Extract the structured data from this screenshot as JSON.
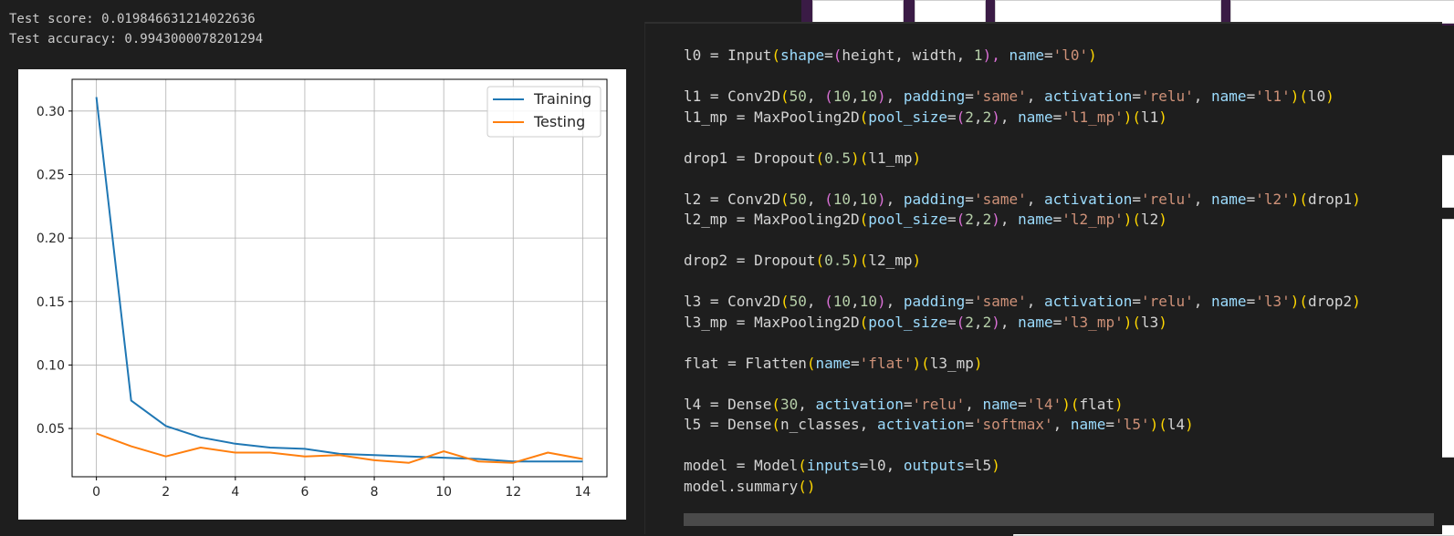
{
  "output": {
    "score_line": "Test score: 0.019846631214022636",
    "accuracy_line": "Test accuracy: 0.9943000078201294"
  },
  "chart_data": {
    "type": "line",
    "x": [
      0,
      1,
      2,
      3,
      4,
      5,
      6,
      7,
      8,
      9,
      10,
      11,
      12,
      13,
      14
    ],
    "series": [
      {
        "name": "Training",
        "color": "#1f77b4",
        "values": [
          0.311,
          0.072,
          0.052,
          0.043,
          0.038,
          0.035,
          0.034,
          0.03,
          0.029,
          0.028,
          0.027,
          0.026,
          0.024,
          0.024,
          0.024
        ]
      },
      {
        "name": "Testing",
        "color": "#ff7f0e",
        "values": [
          0.046,
          0.036,
          0.028,
          0.035,
          0.031,
          0.031,
          0.028,
          0.029,
          0.025,
          0.023,
          0.032,
          0.024,
          0.023,
          0.031,
          0.026
        ]
      }
    ],
    "xlim": [
      -0.7,
      14.7
    ],
    "ylim": [
      0.012,
      0.325
    ],
    "xticks": [
      "0",
      "2",
      "4",
      "6",
      "8",
      "10",
      "12",
      "14"
    ],
    "yticks": [
      "0.05",
      "0.10",
      "0.15",
      "0.20",
      "0.25",
      "0.30"
    ],
    "grid": true,
    "legend": "top-right"
  },
  "code": {
    "lines": [
      [
        [
          "l0 = Input",
          ""
        ],
        [
          "(",
          "p1"
        ],
        [
          "shape",
          "k"
        ],
        [
          "=",
          ""
        ],
        [
          "(",
          "p2"
        ],
        [
          "height, width, ",
          ""
        ],
        [
          "1",
          "n"
        ],
        [
          "), ",
          "p2"
        ],
        [
          "name",
          "k"
        ],
        [
          "=",
          ""
        ],
        [
          "'l0'",
          "s"
        ],
        [
          ")",
          "p1"
        ]
      ],
      [],
      [
        [
          "l1 = Conv2D",
          ""
        ],
        [
          "(",
          "p1"
        ],
        [
          "50",
          "n"
        ],
        [
          ", ",
          ""
        ],
        [
          "(",
          "p2"
        ],
        [
          "10",
          "n"
        ],
        [
          ",",
          ""
        ],
        [
          "10",
          "n"
        ],
        [
          ")",
          "p2"
        ],
        [
          ", ",
          ""
        ],
        [
          "padding",
          "k"
        ],
        [
          "=",
          ""
        ],
        [
          "'same'",
          "s"
        ],
        [
          ", ",
          ""
        ],
        [
          "activation",
          "k"
        ],
        [
          "=",
          ""
        ],
        [
          "'relu'",
          "s"
        ],
        [
          ", ",
          ""
        ],
        [
          "name",
          "k"
        ],
        [
          "=",
          ""
        ],
        [
          "'l1'",
          "s"
        ],
        [
          ")",
          "p1"
        ],
        [
          "(",
          "p1"
        ],
        [
          "l0",
          ""
        ],
        [
          ")",
          "p1"
        ]
      ],
      [
        [
          "l1_mp = MaxPooling2D",
          ""
        ],
        [
          "(",
          "p1"
        ],
        [
          "pool_size",
          "k"
        ],
        [
          "=",
          ""
        ],
        [
          "(",
          "p2"
        ],
        [
          "2",
          "n"
        ],
        [
          ",",
          ""
        ],
        [
          "2",
          "n"
        ],
        [
          ")",
          "p2"
        ],
        [
          ", ",
          ""
        ],
        [
          "name",
          "k"
        ],
        [
          "=",
          ""
        ],
        [
          "'l1_mp'",
          "s"
        ],
        [
          ")",
          "p1"
        ],
        [
          "(",
          "p1"
        ],
        [
          "l1",
          ""
        ],
        [
          ")",
          "p1"
        ]
      ],
      [],
      [
        [
          "drop1 = Dropout",
          ""
        ],
        [
          "(",
          "p1"
        ],
        [
          "0.5",
          "n"
        ],
        [
          ")",
          "p1"
        ],
        [
          "(",
          "p1"
        ],
        [
          "l1_mp",
          ""
        ],
        [
          ")",
          "p1"
        ]
      ],
      [],
      [
        [
          "l2 = Conv2D",
          ""
        ],
        [
          "(",
          "p1"
        ],
        [
          "50",
          "n"
        ],
        [
          ", ",
          ""
        ],
        [
          "(",
          "p2"
        ],
        [
          "10",
          "n"
        ],
        [
          ",",
          ""
        ],
        [
          "10",
          "n"
        ],
        [
          ")",
          "p2"
        ],
        [
          ", ",
          ""
        ],
        [
          "padding",
          "k"
        ],
        [
          "=",
          ""
        ],
        [
          "'same'",
          "s"
        ],
        [
          ", ",
          ""
        ],
        [
          "activation",
          "k"
        ],
        [
          "=",
          ""
        ],
        [
          "'relu'",
          "s"
        ],
        [
          ", ",
          ""
        ],
        [
          "name",
          "k"
        ],
        [
          "=",
          ""
        ],
        [
          "'l2'",
          "s"
        ],
        [
          ")",
          "p1"
        ],
        [
          "(",
          "p1"
        ],
        [
          "drop1",
          ""
        ],
        [
          ")",
          "p1"
        ]
      ],
      [
        [
          "l2_mp = MaxPooling2D",
          ""
        ],
        [
          "(",
          "p1"
        ],
        [
          "pool_size",
          "k"
        ],
        [
          "=",
          ""
        ],
        [
          "(",
          "p2"
        ],
        [
          "2",
          "n"
        ],
        [
          ",",
          ""
        ],
        [
          "2",
          "n"
        ],
        [
          ")",
          "p2"
        ],
        [
          ", ",
          ""
        ],
        [
          "name",
          "k"
        ],
        [
          "=",
          ""
        ],
        [
          "'l2_mp'",
          "s"
        ],
        [
          ")",
          "p1"
        ],
        [
          "(",
          "p1"
        ],
        [
          "l2",
          ""
        ],
        [
          ")",
          "p1"
        ]
      ],
      [],
      [
        [
          "drop2 = Dropout",
          ""
        ],
        [
          "(",
          "p1"
        ],
        [
          "0.5",
          "n"
        ],
        [
          ")",
          "p1"
        ],
        [
          "(",
          "p1"
        ],
        [
          "l2_mp",
          ""
        ],
        [
          ")",
          "p1"
        ]
      ],
      [],
      [
        [
          "l3 = Conv2D",
          ""
        ],
        [
          "(",
          "p1"
        ],
        [
          "50",
          "n"
        ],
        [
          ", ",
          ""
        ],
        [
          "(",
          "p2"
        ],
        [
          "10",
          "n"
        ],
        [
          ",",
          ""
        ],
        [
          "10",
          "n"
        ],
        [
          ")",
          "p2"
        ],
        [
          ", ",
          ""
        ],
        [
          "padding",
          "k"
        ],
        [
          "=",
          ""
        ],
        [
          "'same'",
          "s"
        ],
        [
          ", ",
          ""
        ],
        [
          "activation",
          "k"
        ],
        [
          "=",
          ""
        ],
        [
          "'relu'",
          "s"
        ],
        [
          ", ",
          ""
        ],
        [
          "name",
          "k"
        ],
        [
          "=",
          ""
        ],
        [
          "'l3'",
          "s"
        ],
        [
          ")",
          "p1"
        ],
        [
          "(",
          "p1"
        ],
        [
          "drop2",
          ""
        ],
        [
          ")",
          "p1"
        ]
      ],
      [
        [
          "l3_mp = MaxPooling2D",
          ""
        ],
        [
          "(",
          "p1"
        ],
        [
          "pool_size",
          "k"
        ],
        [
          "=",
          ""
        ],
        [
          "(",
          "p2"
        ],
        [
          "2",
          "n"
        ],
        [
          ",",
          ""
        ],
        [
          "2",
          "n"
        ],
        [
          ")",
          "p2"
        ],
        [
          ", ",
          ""
        ],
        [
          "name",
          "k"
        ],
        [
          "=",
          ""
        ],
        [
          "'l3_mp'",
          "s"
        ],
        [
          ")",
          "p1"
        ],
        [
          "(",
          "p1"
        ],
        [
          "l3",
          ""
        ],
        [
          ")",
          "p1"
        ]
      ],
      [],
      [
        [
          "flat = Flatten",
          ""
        ],
        [
          "(",
          "p1"
        ],
        [
          "name",
          "k"
        ],
        [
          "=",
          ""
        ],
        [
          "'flat'",
          "s"
        ],
        [
          ")",
          "p1"
        ],
        [
          "(",
          "p1"
        ],
        [
          "l3_mp",
          ""
        ],
        [
          ")",
          "p1"
        ]
      ],
      [],
      [
        [
          "l4 = Dense",
          ""
        ],
        [
          "(",
          "p1"
        ],
        [
          "30",
          "n"
        ],
        [
          ", ",
          ""
        ],
        [
          "activation",
          "k"
        ],
        [
          "=",
          ""
        ],
        [
          "'relu'",
          "s"
        ],
        [
          ", ",
          ""
        ],
        [
          "name",
          "k"
        ],
        [
          "=",
          ""
        ],
        [
          "'l4'",
          "s"
        ],
        [
          ")",
          "p1"
        ],
        [
          "(",
          "p1"
        ],
        [
          "flat",
          ""
        ],
        [
          ")",
          "p1"
        ]
      ],
      [
        [
          "l5 = Dense",
          ""
        ],
        [
          "(",
          "p1"
        ],
        [
          "n_classes, ",
          ""
        ],
        [
          "activation",
          "k"
        ],
        [
          "=",
          ""
        ],
        [
          "'softmax'",
          "s"
        ],
        [
          ", ",
          ""
        ],
        [
          "name",
          "k"
        ],
        [
          "=",
          ""
        ],
        [
          "'l5'",
          "s"
        ],
        [
          ")",
          "p1"
        ],
        [
          "(",
          "p1"
        ],
        [
          "l4",
          ""
        ],
        [
          ")",
          "p1"
        ]
      ],
      [],
      [
        [
          "model = Model",
          ""
        ],
        [
          "(",
          "p1"
        ],
        [
          "inputs",
          "k"
        ],
        [
          "=",
          ""
        ],
        [
          "l0, ",
          ""
        ],
        [
          "outputs",
          "k"
        ],
        [
          "=",
          ""
        ],
        [
          "l5",
          ""
        ],
        [
          ")",
          "p1"
        ]
      ],
      [
        [
          "model.summary",
          ""
        ],
        [
          "()",
          "p1"
        ]
      ]
    ]
  }
}
